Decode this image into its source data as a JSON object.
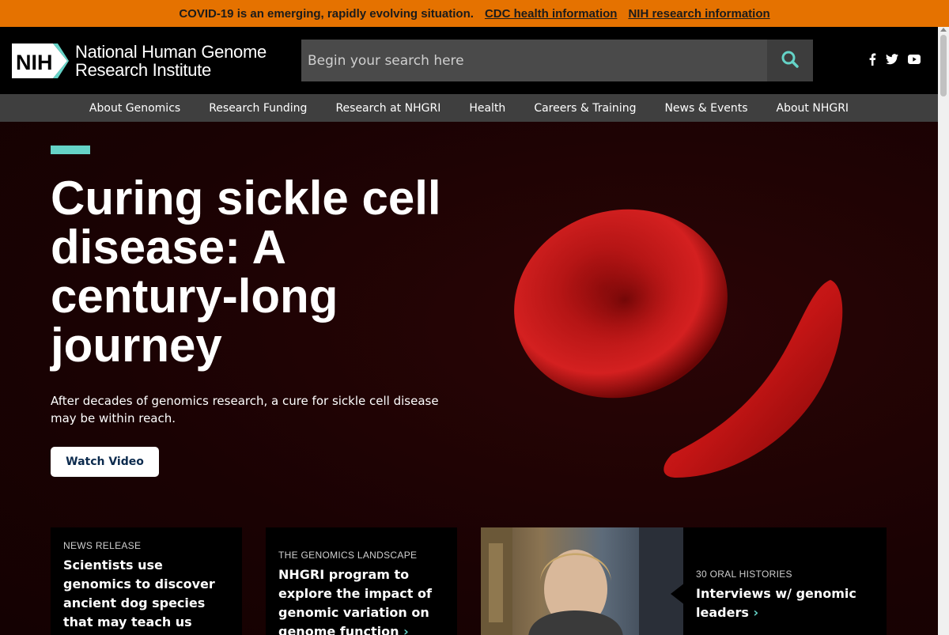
{
  "banner": {
    "message": "COVID-19 is an emerging, rapidly evolving situation.",
    "link_cdc": "CDC health information",
    "link_nih": "NIH research information"
  },
  "header": {
    "logo_abbr": "NIH",
    "logo_line1": "National Human Genome",
    "logo_line2": "Research Institute",
    "search_placeholder": "Begin your search here",
    "social_icons": [
      "facebook-icon",
      "twitter-icon",
      "youtube-icon"
    ]
  },
  "nav": {
    "items": [
      "About Genomics",
      "Research Funding",
      "Research at NHGRI",
      "Health",
      "Careers & Training",
      "News & Events",
      "About NHGRI"
    ]
  },
  "hero": {
    "title": "Curing sickle cell disease: A century-long journey",
    "description": "After decades of genomics research, a cure for sickle cell disease may be within reach.",
    "button_label": "Watch Video",
    "accent_color": "#65d3c7"
  },
  "cards": [
    {
      "kicker": "NEWS RELEASE",
      "title": "Scientists use genomics to discover ancient dog species that may teach us about human"
    },
    {
      "kicker": "THE GENOMICS LANDSCAPE",
      "title": "NHGRI program to explore the impact of genomic variation on genome function",
      "chevron": "›"
    },
    {
      "kicker": "30 ORAL HISTORIES",
      "title": "Interviews w/ genomic leaders",
      "chevron": "›"
    }
  ],
  "colors": {
    "banner_bg": "#e57200",
    "header_bg": "#000000",
    "nav_bg": "#3f3f3f",
    "hero_bg": "#1a0203",
    "accent": "#65d3c7"
  }
}
